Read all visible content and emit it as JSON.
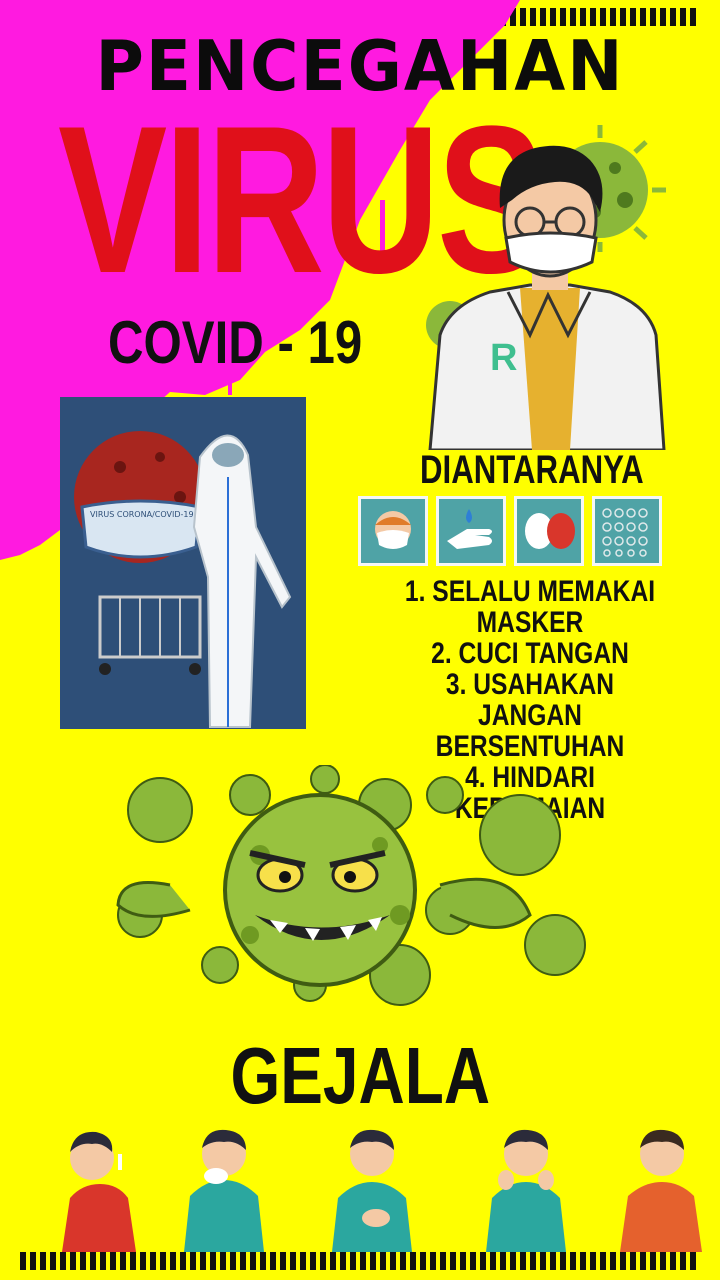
{
  "poster": {
    "title_top": "PENCEGAHAN",
    "title_main": "VIRUS",
    "subtitle": "COVID - 19",
    "section_label": "DIANTARANYA",
    "panel_label": "VIRUS CORONA/COVID-19",
    "doctor_badge": "R",
    "rules": [
      "1. SELALU MEMAKAI",
      "MASKER",
      "2. CUCI TANGAN",
      "3. USAHAKAN JANGAN",
      "BERSENTUHAN",
      "4. HINDARI KERAMAIAN"
    ],
    "symptoms_title": "GEJALA"
  },
  "icons": [
    "face-mask-icon",
    "hand-wash-icon",
    "avoid-contact-icon",
    "crowd-icon"
  ],
  "colors": {
    "background": "#ffff00",
    "splash": "#ff1ae0",
    "virus_title": "#e0101a",
    "tile": "#4fa3a6",
    "virus_green": "#8bb83a"
  }
}
